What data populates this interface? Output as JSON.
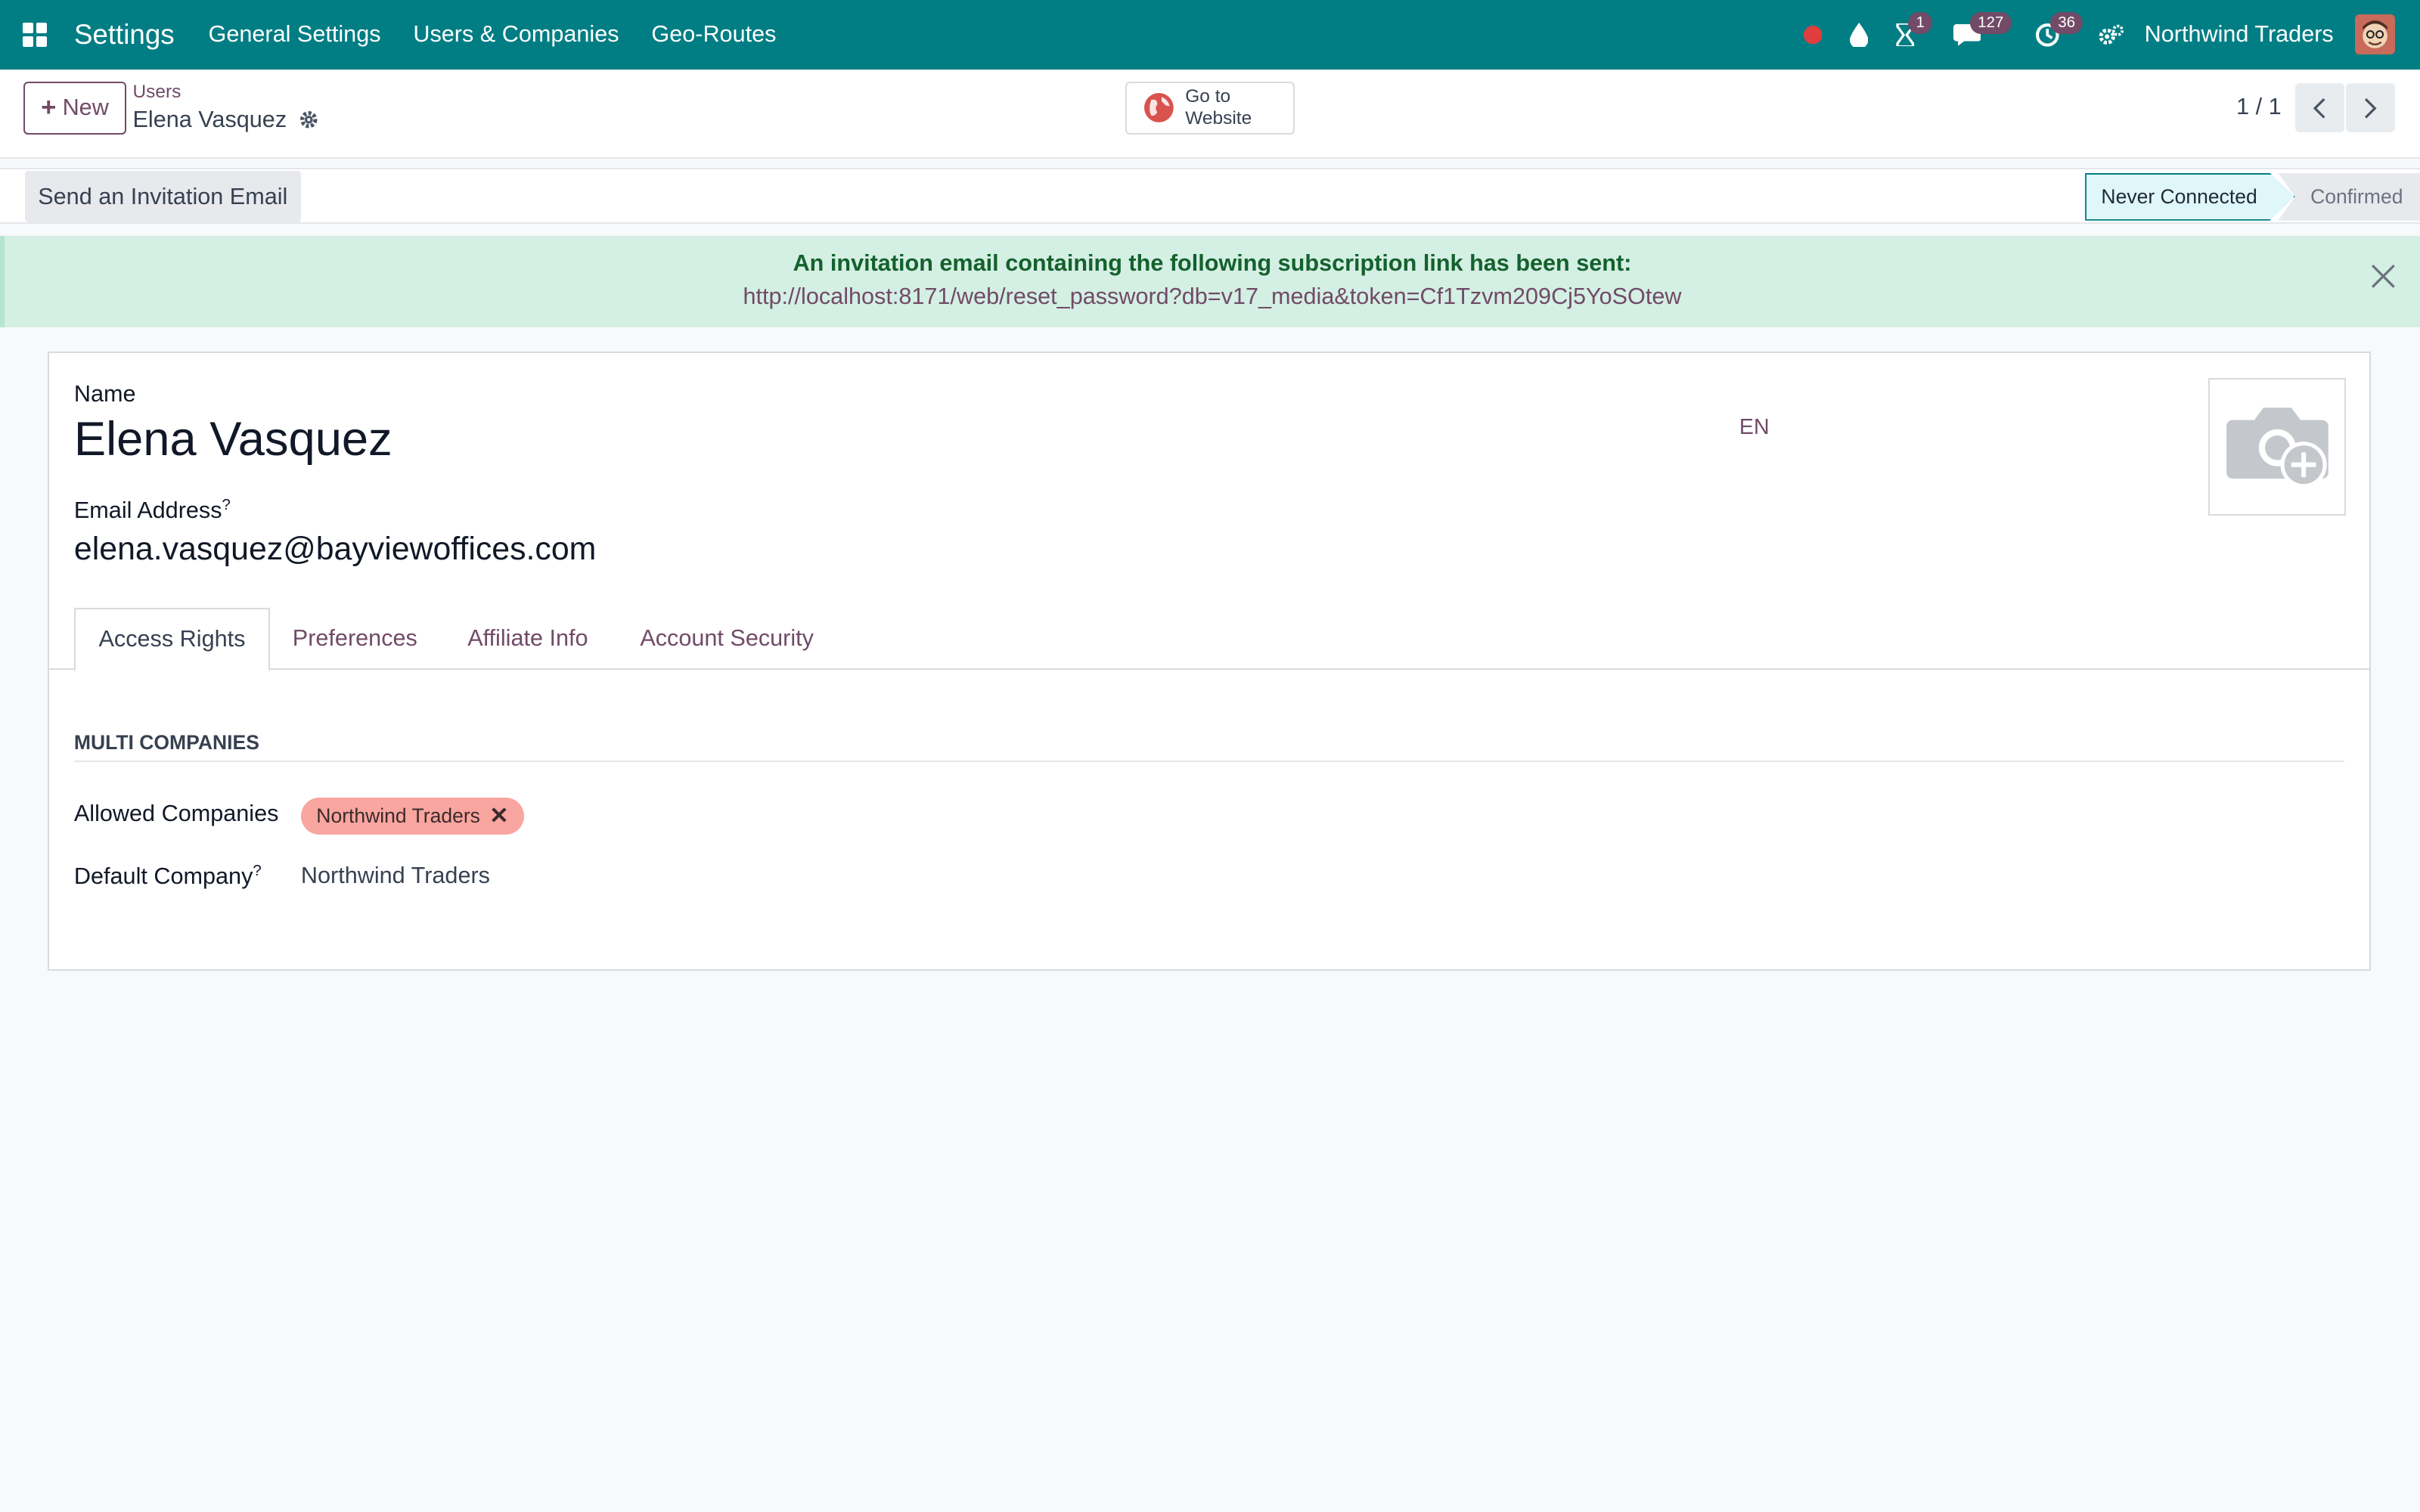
{
  "navbar": {
    "app_name": "Settings",
    "menus": [
      "General Settings",
      "Users & Companies",
      "Geo-Routes"
    ],
    "activity_badge": "1",
    "messages_badge": "127",
    "clock_badge": "36",
    "company": "Northwind Traders",
    "color": "#017e84"
  },
  "control": {
    "new_label": "New",
    "breadcrumb_parent": "Users",
    "breadcrumb_current": "Elena Vasquez",
    "website_label": "Go to Website",
    "pager": "1 / 1"
  },
  "statusbar": {
    "invite_label": "Send an Invitation Email",
    "stages": [
      "Never Connected",
      "Confirmed"
    ],
    "active_stage": "Never Connected"
  },
  "alert": {
    "message": "An invitation email containing the following subscription link has been sent:",
    "link": "http://localhost:8171/web/reset_password?db=v17_media&token=Cf1Tzvm209Cj5YoSOtew"
  },
  "form": {
    "name_label": "Name",
    "name_value": "Elena Vasquez",
    "lang": "EN",
    "email_label": "Email Address",
    "email_value": "elena.vasquez@bayviewoffices.com",
    "tabs": [
      "Access Rights",
      "Preferences",
      "Affiliate Info",
      "Account Security"
    ],
    "active_tab": "Access Rights",
    "section_title": "Multi Companies",
    "allowed_companies_label": "Allowed Companies",
    "allowed_companies": [
      "Northwind Traders"
    ],
    "default_company_label": "Default Company",
    "default_company_value": "Northwind Traders"
  }
}
